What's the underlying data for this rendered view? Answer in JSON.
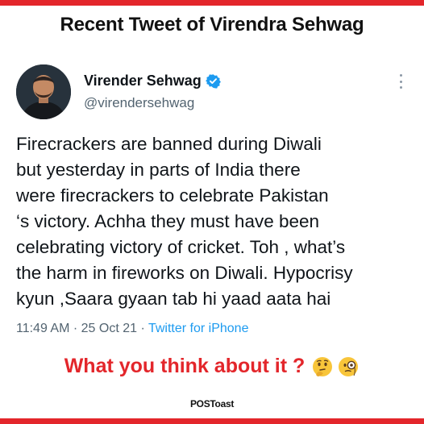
{
  "headline": "Recent Tweet of Virendra Sehwag",
  "tweet": {
    "display_name": "Virender Sehwag",
    "handle": "@virendersehwag",
    "verified": true,
    "body_lines": [
      "Firecrackers are banned during Diwali",
      "but yesterday in parts of India there",
      "were firecrackers to celebrate Pakistan",
      "‘s victory. Achha they must have been",
      "celebrating victory of cricket. Toh , what’s",
      "the harm in fireworks on Diwali. Hypocrisy",
      "kyun ,Saara gyaan tab hi yaad aata hai"
    ],
    "time": "11:49 AM",
    "date": "25 Oct 21",
    "separator": "·",
    "source": "Twitter for iPhone"
  },
  "question": "What you think about it ?",
  "question_emojis": [
    "thinking-face-icon",
    "face-with-monocle-icon"
  ],
  "brand": "POSToast",
  "colors": {
    "accent_red": "#e3262b",
    "twitter_blue": "#1d9bf0",
    "meta_gray": "#536471"
  }
}
